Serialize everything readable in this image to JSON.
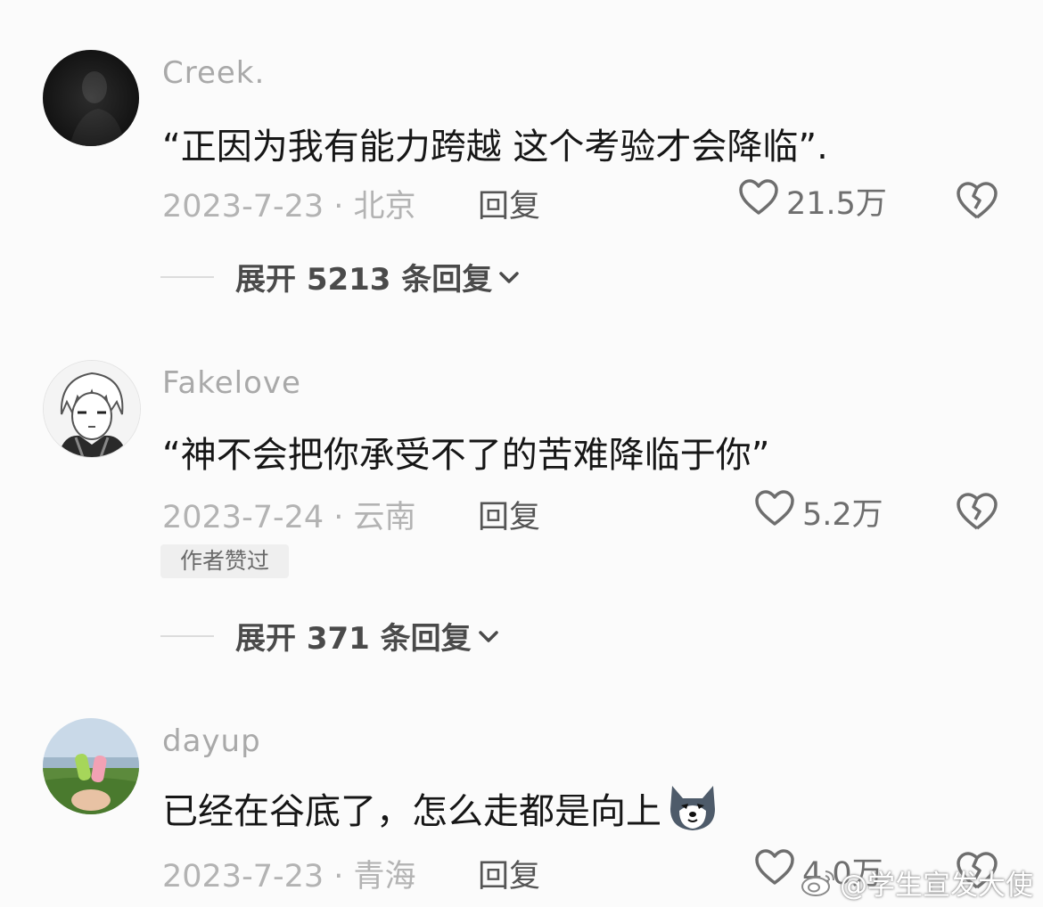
{
  "comments": [
    {
      "username": "Creek.",
      "text": "“正因为我有能力跨越 这个考验才会降临”.",
      "date_location": "2023-7-23 · 北京",
      "reply_label": "回复",
      "likes": "21.5万",
      "expand_label": "展开 5213 条回复"
    },
    {
      "username": "Fakelove",
      "text": "“神不会把你承受不了的苦难降临于你”",
      "date_location": "2023-7-24 · 云南",
      "reply_label": "回复",
      "likes": "5.2万",
      "badge": "作者赞过",
      "expand_label": "展开 371 条回复"
    },
    {
      "username": "dayup",
      "text": "已经在谷底了，怎么走都是向上",
      "emoji_icon": "wolf-face-icon",
      "date_location": "2023-7-23 · 青海",
      "reply_label": "回复",
      "likes": "4.0万"
    }
  ],
  "watermark": "@学生宣发大使",
  "colors": {
    "background": "#fbfbfb",
    "username": "#a9a9a9",
    "meta": "#b3b3b3",
    "content": "#161616"
  }
}
